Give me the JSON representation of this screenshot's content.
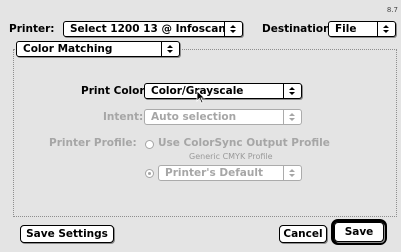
{
  "version": "8.7",
  "header": {
    "printer_label": "Printer:",
    "printer_value": "Select 1200 13 @ Infoscan",
    "destination_label": "Destination:",
    "destination_value": "File"
  },
  "panel": {
    "value": "Color Matching"
  },
  "print_color": {
    "label": "Print Color:",
    "value": "Color/Grayscale"
  },
  "intent": {
    "label": "Intent:",
    "value": "Auto selection"
  },
  "printer_profile": {
    "label": "Printer Profile:",
    "option1": "Use ColorSync Output Profile",
    "option1_sub": "Generic CMYK Profile",
    "option2_value": "Printer's Default"
  },
  "buttons": {
    "save_settings": "Save Settings",
    "cancel": "Cancel",
    "save": "Save"
  }
}
